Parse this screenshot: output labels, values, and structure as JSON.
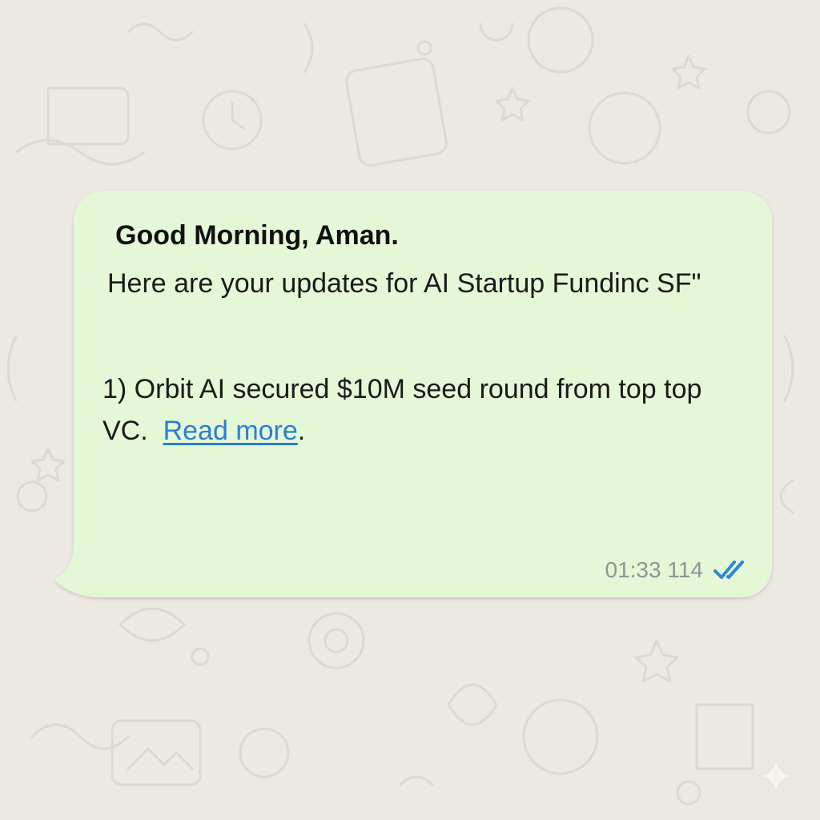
{
  "message": {
    "greeting": "Good Morning, Aman.",
    "intro": "Here are your updates for AI Startup Fundinc SF\"",
    "item_text": "1) Orbit AI secured $10M seed round from top top VC.",
    "link_label": "Read more",
    "link_suffix": ".",
    "timestamp": "01:33 114",
    "status_icon": "double-check-icon"
  },
  "colors": {
    "bubble": "#E4F7D7",
    "background": "#ECE8E2",
    "link": "#2B7FCF",
    "ticks": "#2F86D7",
    "timestamp": "#8F9693"
  }
}
